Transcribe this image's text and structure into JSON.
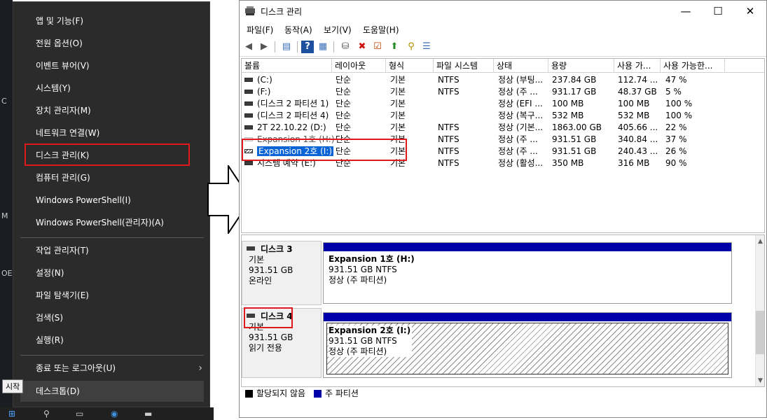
{
  "left_edge": {
    "fragments": [
      "C",
      "M",
      "OE"
    ]
  },
  "winx_menu": {
    "items": [
      "앱 및 기능(F)",
      "전원 옵션(O)",
      "이벤트 뷰어(V)",
      "시스템(Y)",
      "장치 관리자(M)",
      "네트워크 연결(W)",
      "디스크 관리(K)",
      "컴퓨터 관리(G)",
      "Windows PowerShell(I)",
      "Windows PowerShell(관리자)(A)"
    ],
    "items2": [
      "작업 관리자(T)",
      "설정(N)",
      "파일 탐색기(E)",
      "검색(S)",
      "실행(R)"
    ],
    "items3": [
      "종료 또는 로그아웃(U)",
      "데스크톱(D)"
    ],
    "submenu_arrow": "›",
    "tooltip": "시작"
  },
  "window": {
    "title": "디스크 관리",
    "menu": [
      "파일(F)",
      "동작(A)",
      "보기(V)",
      "도움말(H)"
    ],
    "controls": {
      "minimize": "—",
      "maximize": "☐",
      "close": "✕"
    }
  },
  "volume_list": {
    "columns": [
      "볼륨",
      "레이아웃",
      "형식",
      "파일 시스템",
      "상태",
      "용량",
      "사용 가...",
      "사용 가능한..."
    ],
    "rows": [
      [
        "(C:)",
        "단순",
        "기본",
        "NTFS",
        "정상 (부팅...",
        "237.84 GB",
        "112.74 ...",
        "47 %"
      ],
      [
        "(F:)",
        "단순",
        "기본",
        "NTFS",
        "정상 (주 ...",
        "931.17 GB",
        "48.37 GB",
        "5 %"
      ],
      [
        "(디스크 2 파티션 1)",
        "단순",
        "기본",
        "",
        "정상 (EFI ...",
        "100 MB",
        "100 MB",
        "100 %"
      ],
      [
        "(디스크 2 파티션 4)",
        "단순",
        "기본",
        "",
        "정상 (복구...",
        "532 MB",
        "532 MB",
        "100 %"
      ],
      [
        "2T 22.10.22 (D:)",
        "단순",
        "기본",
        "NTFS",
        "정상 (기본...",
        "1863.00 GB",
        "405.66 ...",
        "22 %"
      ],
      [
        "Expansion 1호 (H:)",
        "단순",
        "기본",
        "NTFS",
        "정상 (주 ...",
        "931.51 GB",
        "340.84 ...",
        "37 %"
      ],
      [
        "Expansion 2호 (I:)",
        "단순",
        "기본",
        "NTFS",
        "정상 (주 ...",
        "931.51 GB",
        "240.43 ...",
        "26 %"
      ],
      [
        "시스템 예약 (E:)",
        "단순",
        "기본",
        "NTFS",
        "정상 (활성...",
        "350 MB",
        "316 MB",
        "90 %"
      ]
    ]
  },
  "disks": [
    {
      "name": "디스크 3",
      "type": "기본",
      "size": "931.51 GB",
      "status": "온라인",
      "partition": {
        "label": "Expansion 1호  (H:)",
        "size": "931.51 GB NTFS",
        "status": "정상 (주 파티션)"
      }
    },
    {
      "name": "디스크 4",
      "type": "기본",
      "size": "931.51 GB",
      "status": "읽기 전용",
      "partition": {
        "label": "Expansion 2호  (I:)",
        "size": "931.51 GB NTFS",
        "status": "정상 (주 파티션)"
      }
    }
  ],
  "legend": {
    "unallocated": "할당되지 않음",
    "primary": "주 파티션",
    "unallocated_color": "#000000",
    "primary_color": "#0000a8"
  },
  "colors": {
    "highlight": "#e0191e",
    "selection": "#0a64d6",
    "menu_bg": "#2b2b2b"
  }
}
